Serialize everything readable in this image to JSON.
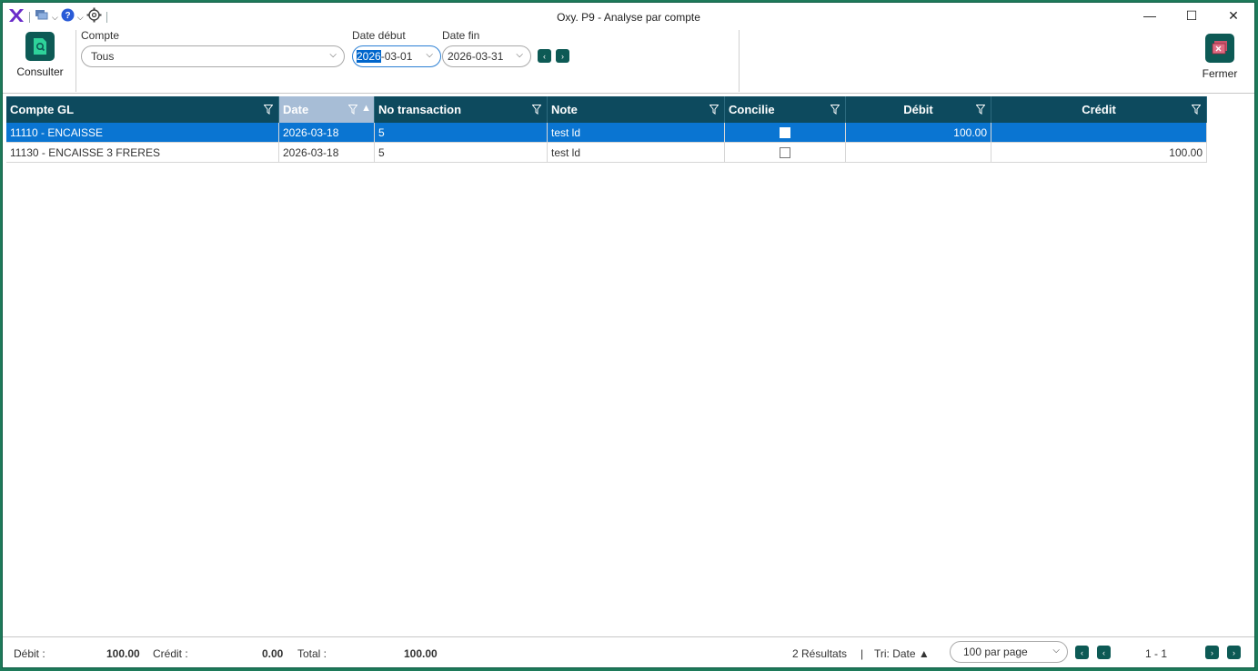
{
  "window": {
    "title": "Oxy. P9 - Analyse par compte",
    "controls": {
      "minimize": "—",
      "maximize": "☐",
      "close": "✕"
    }
  },
  "ribbon": {
    "consult_label": "Consulter",
    "close_label": "Fermer",
    "compte_label": "Compte",
    "compte_value": "Tous",
    "date_debut_label": "Date début",
    "date_debut_year": "2026",
    "date_debut_rest": "-03-01",
    "date_fin_label": "Date fin",
    "date_fin_value": "2026-03-31",
    "prev_arrow": "‹",
    "next_arrow": "›"
  },
  "grid": {
    "columns": [
      {
        "label": "Compte GL"
      },
      {
        "label": "Date"
      },
      {
        "label": "No transaction"
      },
      {
        "label": "Note"
      },
      {
        "label": "Concilie"
      },
      {
        "label": "Débit"
      },
      {
        "label": "Crédit"
      }
    ],
    "sort_arrow": "▲",
    "rows": [
      {
        "compte": "11110 - ENCAISSE",
        "date": "2026-03-18",
        "no": "5",
        "note": "test ld",
        "concilie": false,
        "debit": "100.00",
        "credit": "",
        "selected": true
      },
      {
        "compte": "11130 - ENCAISSE 3 FRERES",
        "date": "2026-03-18",
        "no": "5",
        "note": "test ld",
        "concilie": false,
        "debit": "",
        "credit": "100.00",
        "selected": false
      }
    ]
  },
  "footer": {
    "debit_label": "Débit :",
    "debit_value": "100.00",
    "credit_label": "Crédit :",
    "credit_value": "0.00",
    "total_label": "Total :",
    "total_value": "100.00",
    "results": "2 Résultats",
    "divider": "|",
    "sort_label": "Tri: Date",
    "sort_arrow": "▲",
    "per_page": "100 par page",
    "page_range": "1 - 1",
    "first": "‹",
    "prev": "‹",
    "next": "›",
    "last": "›"
  },
  "colors": {
    "accent": "#0d5a55",
    "header": "#0d4a5e",
    "selected_row": "#0a75d2",
    "frame": "#1e7a5a"
  }
}
